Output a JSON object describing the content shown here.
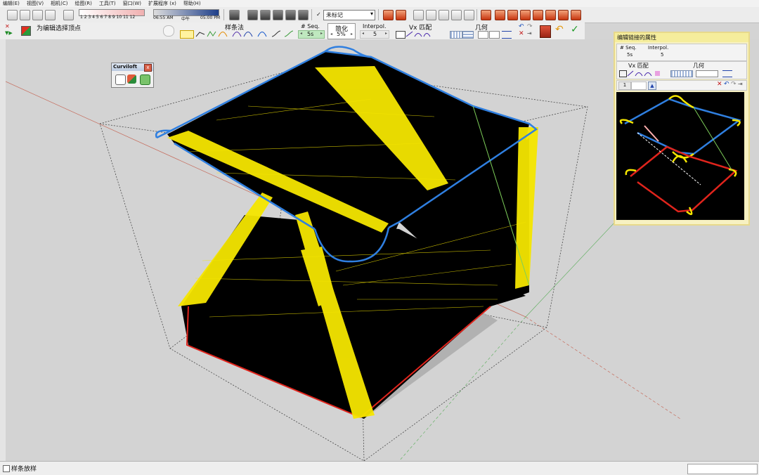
{
  "menubar": {
    "items": [
      "编辑(E)",
      "视图(V)",
      "相机(C)",
      "绘图(R)",
      "工具(T)",
      "窗口(W)",
      "扩展程序 (x)",
      "帮助(H)"
    ]
  },
  "toolbar1": {
    "timeline_numbers": "1 2 3 4 5 6 7 8 9 10 11 12",
    "time_am": "06:55 AM",
    "time_noon": "中午",
    "time_pm": "05:00 PM",
    "layer_check": "✓",
    "layer_dropdown": "未标记"
  },
  "toolbar2": {
    "close_mark": "✕",
    "hint": "为编辑选择顶点",
    "spline_method": "样条法",
    "seq_label": "# Seq.",
    "seq_value": "5s",
    "simplify_label": "简化",
    "simplify_value": "5%",
    "interpol_label": "Interpol.",
    "interpol_value": "5",
    "vx_match": "Vx 匹配",
    "geometry": "几何"
  },
  "curviloft": {
    "title": "Curviloft",
    "close": "x"
  },
  "props_panel": {
    "title": "编辑链接的属性",
    "seq_label": "# Seq.",
    "seq_value": "5s",
    "interpol_label": "Interpol.",
    "interpol_value": "5",
    "vx_match": "Vx 匹配",
    "geometry": "几何",
    "tab_label": "1"
  },
  "statusbar": {
    "text": "样条放样"
  },
  "colors": {
    "edge_blue": "#2f7fe0",
    "edge_red": "#e0241c",
    "loft_yellow": "#f5e600",
    "surface": "#000000",
    "panel_yellow": "#f5ed9c"
  }
}
